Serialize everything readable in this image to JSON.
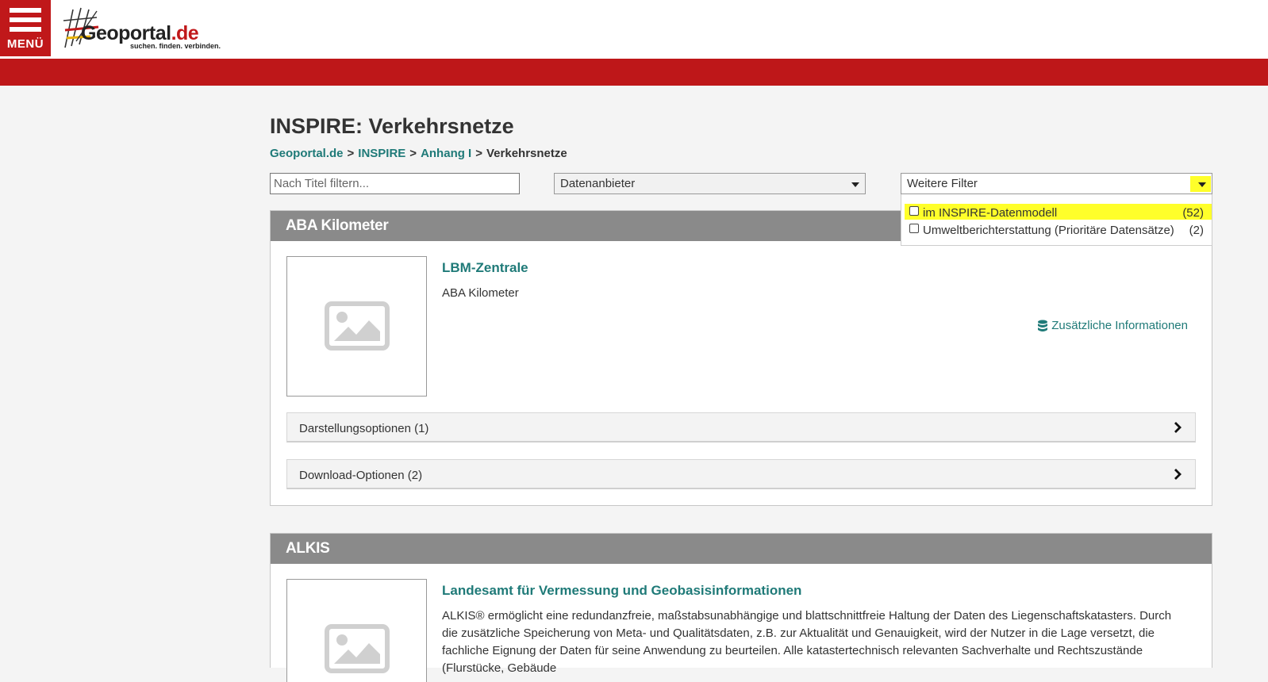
{
  "header": {
    "menu_label": "MENÜ",
    "logo_name": "Geoportal",
    "logo_tld": ".de",
    "logo_tagline": "suchen. finden. verbinden."
  },
  "page": {
    "title": "INSPIRE: Verkehrsnetze",
    "breadcrumb": [
      {
        "label": "Geoportal.de",
        "link": true
      },
      {
        "label": "INSPIRE",
        "link": true
      },
      {
        "label": "Anhang I",
        "link": true
      },
      {
        "label": "Verkehrsnetze",
        "link": false
      }
    ],
    "breadcrumb_separator": ">"
  },
  "filters": {
    "title_placeholder": "Nach Titel filtern...",
    "provider_label": "Datenanbieter",
    "more_label": "Weitere Filter",
    "more_options": [
      {
        "label": "im INSPIRE-Datenmodell",
        "count": "(52)",
        "checked": false,
        "highlighted": true
      },
      {
        "label": "Umweltberichterstattung (Prioritäre Datensätze)",
        "count": "(2)",
        "checked": false,
        "highlighted": false
      }
    ]
  },
  "results": [
    {
      "title": "ABA Kilometer",
      "provider": "LBM-Zentrale",
      "dataset": "ABA Kilometer",
      "more_info": "Zusätzliche Informationen",
      "options": [
        "Darstellungsoptionen (1)",
        "Download-Optionen (2)"
      ],
      "thumbnail_icon": "image-placeholder-icon"
    },
    {
      "title": "ALKIS",
      "provider": "Landesamt für Vermessung und Geobasisinformationen",
      "description": "ALKIS® ermöglicht eine redundanzfreie, maßstabsunabhängige und blattschnittfreie Haltung der Daten des Liegenschaftskatasters. Durch die zusätzliche Speicherung von Meta- und Qualitätsdaten, z.B. zur Aktualität und Genauigkeit, wird der Nutzer in die Lage versetzt, die fachliche Eignung der Daten für seine Anwendung zu beurteilen. Alle katastertechnisch relevanten Sachverhalte und Rechtszustände (Flurstücke, Gebäude",
      "thumbnail_icon": "image-placeholder-icon"
    }
  ],
  "colors": {
    "brand_red": "#c0181a",
    "link_teal": "#1f7a78",
    "card_header_gray": "#8a8a8a",
    "highlight_yellow": "#ffff2a"
  }
}
